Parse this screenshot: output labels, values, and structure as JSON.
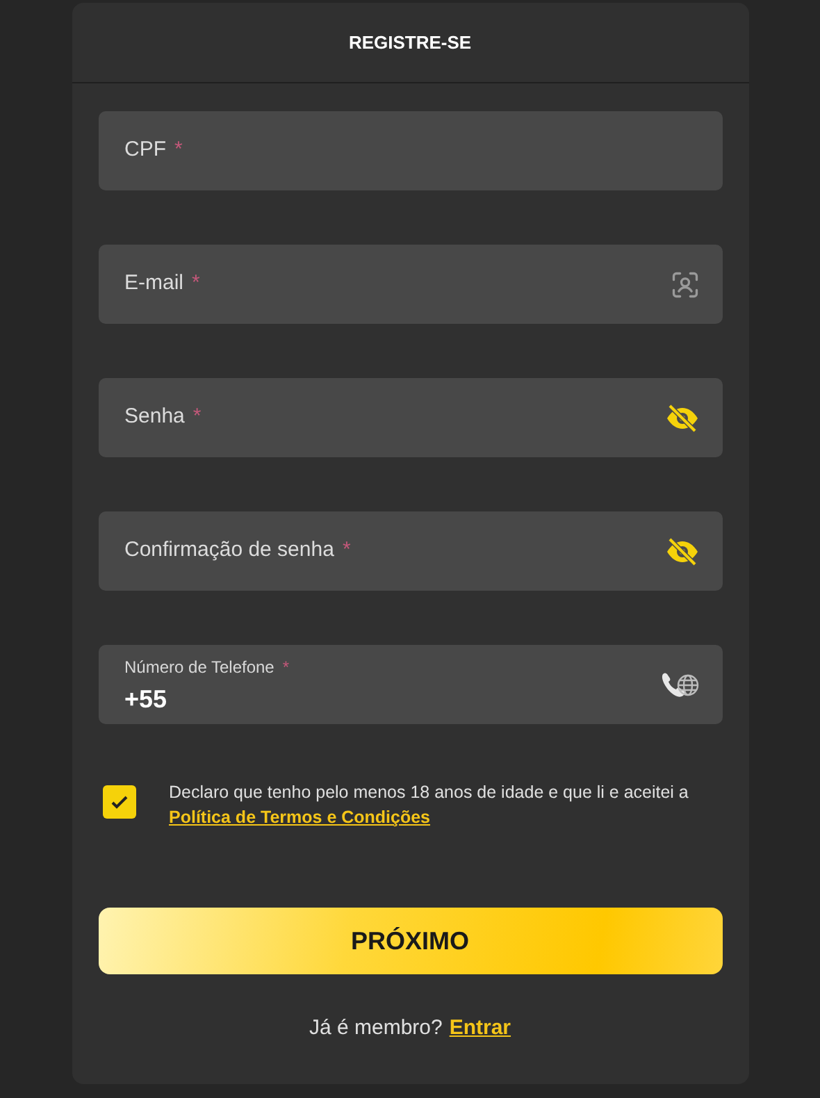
{
  "header": {
    "title": "REGISTRE-SE"
  },
  "fields": [
    {
      "kind": "plain",
      "label": "CPF",
      "required_mark": "*"
    },
    {
      "kind": "email",
      "label": "E-mail",
      "required_mark": "*"
    },
    {
      "kind": "password",
      "label": "Senha",
      "required_mark": "*"
    },
    {
      "kind": "password",
      "label": "Confirmação de senha",
      "required_mark": "*"
    },
    {
      "kind": "phone",
      "label": "Número de Telefone",
      "required_mark": "*",
      "value": "+55"
    }
  ],
  "agreement": {
    "checked": true,
    "text": "Declaro que tenho pelo menos 18 anos de idade e que li e aceitei a",
    "link": "Política de Termos e Condições"
  },
  "next_button": {
    "label": "PRÓXIMO"
  },
  "footer": {
    "text": "Já é membro?",
    "link": "Entrar"
  }
}
